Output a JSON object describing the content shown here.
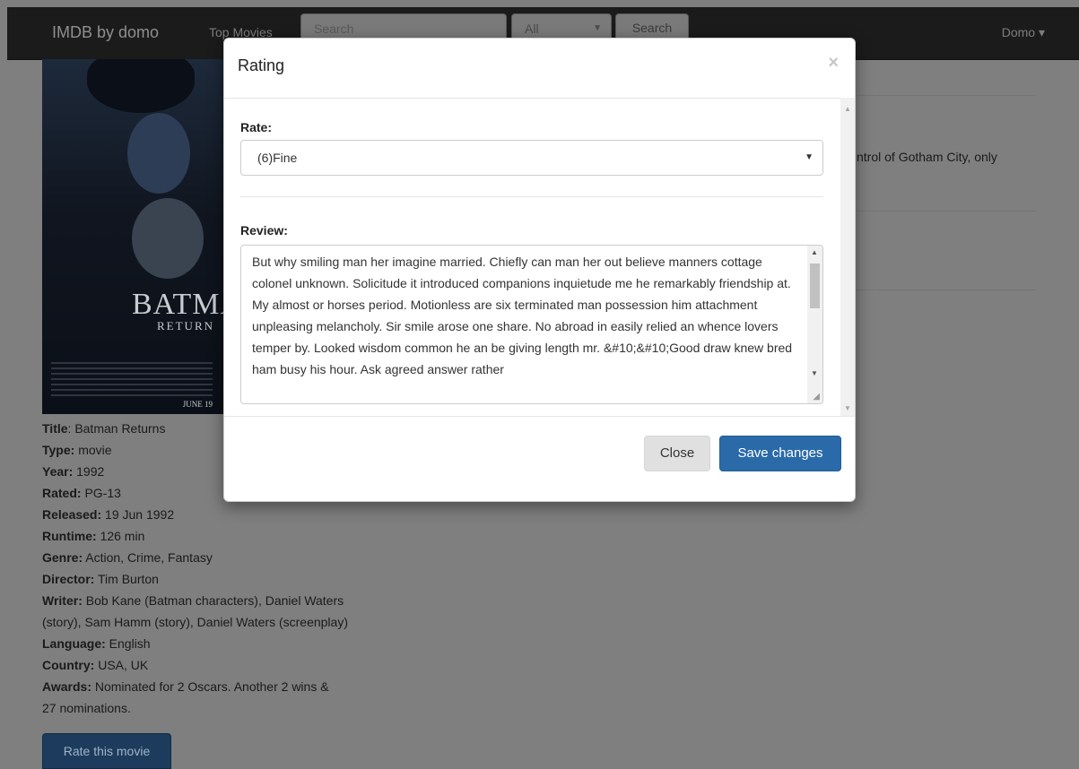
{
  "navbar": {
    "brand": "IMDB by domo",
    "top_movies_link": "Top Movies",
    "search_placeholder": "Search",
    "filter_value": "All",
    "search_button": "Search",
    "user_menu": "Domo"
  },
  "poster": {
    "title": "BATMA",
    "subtitle": "RETURN",
    "date": "JUNE 19"
  },
  "movie": {
    "title_label": "Title",
    "title": "Batman Returns",
    "type_label": "Type:",
    "type": "movie",
    "year_label": "Year:",
    "year": "1992",
    "rated_label": "Rated:",
    "rated": "PG-13",
    "released_label": "Released:",
    "released": "19 Jun 1992",
    "runtime_label": "Runtime:",
    "runtime": "126 min",
    "genre_label": "Genre:",
    "genre": "Action, Crime, Fantasy",
    "director_label": "Director:",
    "director": "Tim Burton",
    "writer_label": "Writer:",
    "writer": "Bob Kane (Batman characters), Daniel Waters (story), Sam Hamm (story), Daniel Waters (screenplay)",
    "language_label": "Language:",
    "language": "English",
    "country_label": "Country:",
    "country": "USA, UK",
    "awards_label": "Awards:",
    "awards": "Nominated for 2 Oscars. Another 2 wins & 27 nominations.",
    "plot_fragment": "ntrol of Gotham City, only",
    "rate_button": "Rate this movie"
  },
  "modal": {
    "title": "Rating",
    "close_icon": "×",
    "rate_label": "Rate:",
    "rate_value": "(6)Fine",
    "review_label": "Review:",
    "review_text": "But why smiling man her imagine married. Chiefly can man her out believe manners cottage colonel unknown. Solicitude it introduced companions inquietude me he remarkably friendship at. My almost or horses period. Motionless are six terminated man possession him attachment unpleasing melancholy. Sir smile arose one share. No abroad in easily relied an whence lovers temper by. Looked wisdom common he an be giving length mr. &#10;&#10;Good draw knew bred ham busy his hour. Ask agreed answer rather",
    "close_button": "Close",
    "save_button": "Save changes"
  }
}
